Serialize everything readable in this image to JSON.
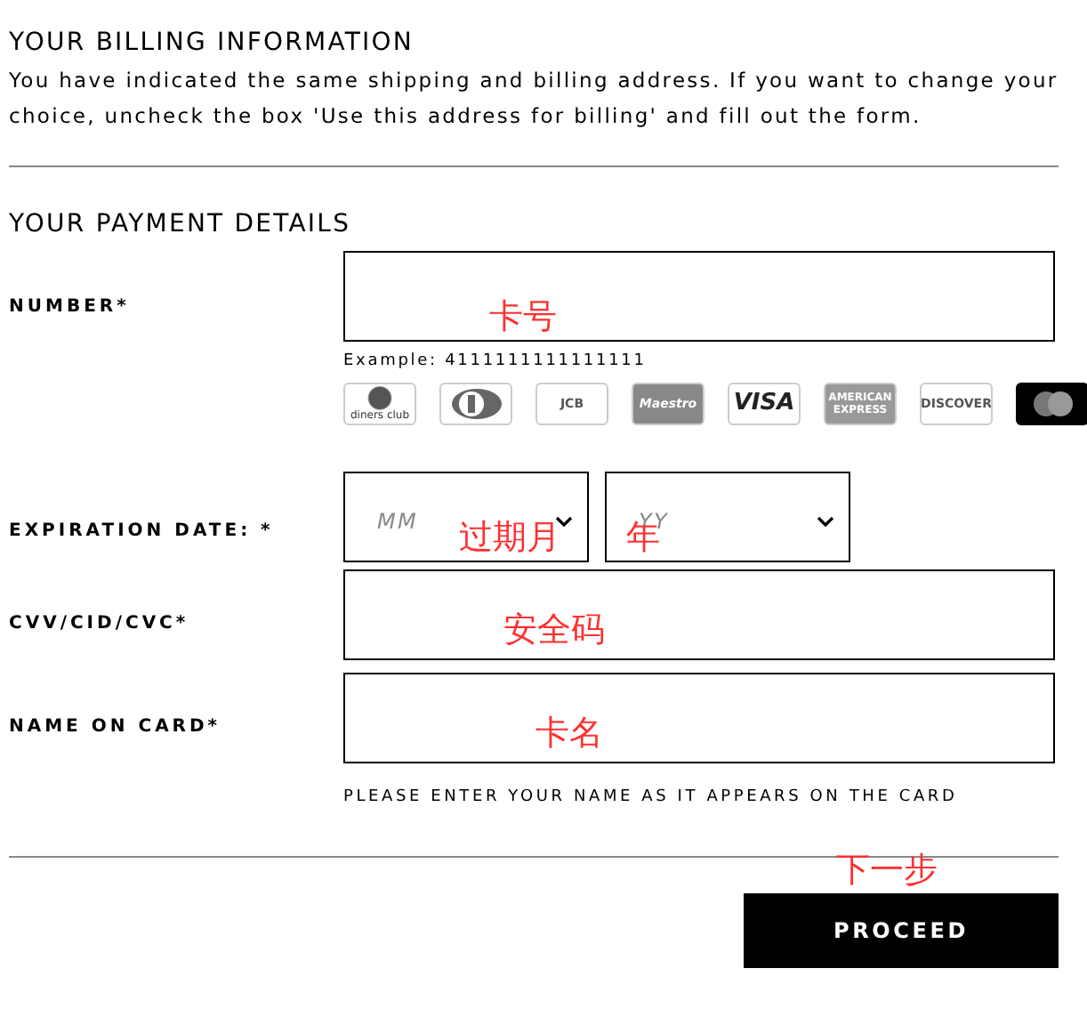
{
  "billing": {
    "heading": "YOUR BILLING INFORMATION",
    "text": "You have indicated the same shipping and billing address. If you want to change your choice, uncheck the box 'Use this address for billing' and fill out the form."
  },
  "payment": {
    "heading": "YOUR PAYMENT DETAILS",
    "number": {
      "label": "NUMBER*",
      "annotation": "卡号",
      "example": "Example: 4111111111111111",
      "cards": [
        {
          "kind": "circles",
          "label": "diners club"
        },
        {
          "kind": "circles"
        },
        {
          "kind": "text",
          "label": "JCB"
        },
        {
          "kind": "maestro",
          "label": "Maestro"
        },
        {
          "kind": "bold",
          "label": "VISA"
        },
        {
          "kind": "grey",
          "label": "AMERICAN EXPRESS"
        },
        {
          "kind": "text",
          "label": "DISCOVER"
        },
        {
          "kind": "dark"
        }
      ]
    },
    "expiration": {
      "label": "EXPIRATION DATE: *",
      "selects": [
        {
          "placeholder": "MM",
          "annotation": "过期月"
        },
        {
          "placeholder": "YY",
          "annotation": "年"
        }
      ]
    },
    "cvv": {
      "label": "CVV/CID/CVC*",
      "annotation": "安全码"
    },
    "name": {
      "label": "NAME ON CARD*",
      "annotation": "卡名",
      "hint": "PLEASE ENTER YOUR NAME AS IT APPEARS ON THE CARD"
    }
  },
  "proceed": {
    "label": "PROCEED",
    "annotation": "下一步"
  }
}
